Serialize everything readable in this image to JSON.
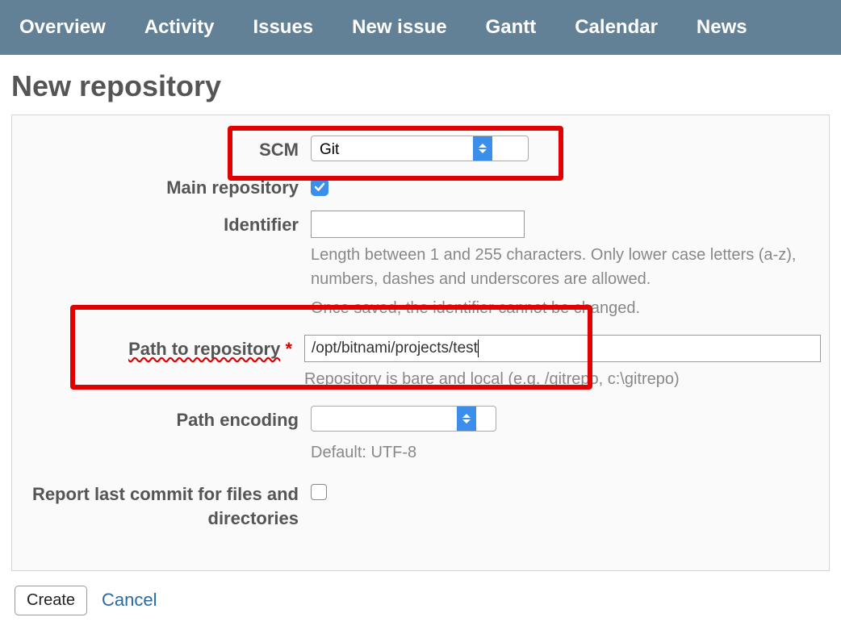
{
  "nav": {
    "items": [
      {
        "label": "Overview"
      },
      {
        "label": "Activity"
      },
      {
        "label": "Issues"
      },
      {
        "label": "New issue"
      },
      {
        "label": "Gantt"
      },
      {
        "label": "Calendar"
      },
      {
        "label": "News"
      }
    ]
  },
  "page": {
    "title": "New repository"
  },
  "form": {
    "scm": {
      "label": "SCM",
      "selected": "Git"
    },
    "main_repo": {
      "label": "Main repository",
      "checked": true
    },
    "identifier": {
      "label": "Identifier",
      "value": "",
      "hint1": "Length between 1 and 255 characters. Only lower case letters (a-z), numbers, dashes and underscores are allowed.",
      "hint2": "Once saved, the identifier cannot be changed."
    },
    "path": {
      "label": "Path to repository",
      "required_mark": "*",
      "value": "/opt/bitnami/projects/test",
      "hint": "Repository is bare and local (e.g. /gitrepo, c:\\gitrepo)"
    },
    "encoding": {
      "label": "Path encoding",
      "selected": "",
      "hint": "Default: UTF-8"
    },
    "report_last": {
      "label": "Report last commit for files and directories",
      "checked": false
    }
  },
  "actions": {
    "create": "Create",
    "cancel": "Cancel"
  }
}
